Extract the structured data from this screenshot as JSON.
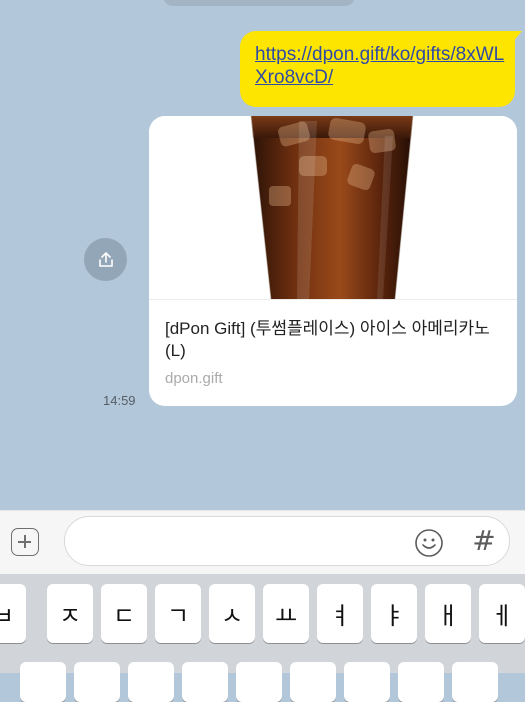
{
  "messages": {
    "link_text": "https://dpon.gift/ko/gifts/8xWLXro8vcD/",
    "card_title": "[dPon Gift] (투썸플레이스) 아이스 아메리카노(L)",
    "card_domain": "dpon.gift",
    "time": "14:59"
  },
  "input": {
    "placeholder": "",
    "hash_label": "#"
  },
  "keyboard": {
    "row1": [
      "ㅂ",
      "ㅈ",
      "ㄷ",
      "ㄱ",
      "ㅅ",
      "ㅛ",
      "ㅕ",
      "ㅑ",
      "ㅐ",
      "ㅔ"
    ]
  },
  "colors": {
    "chat_background": "#b2c7d9",
    "my_bubble": "#fee500",
    "link": "#2f4ba6"
  }
}
